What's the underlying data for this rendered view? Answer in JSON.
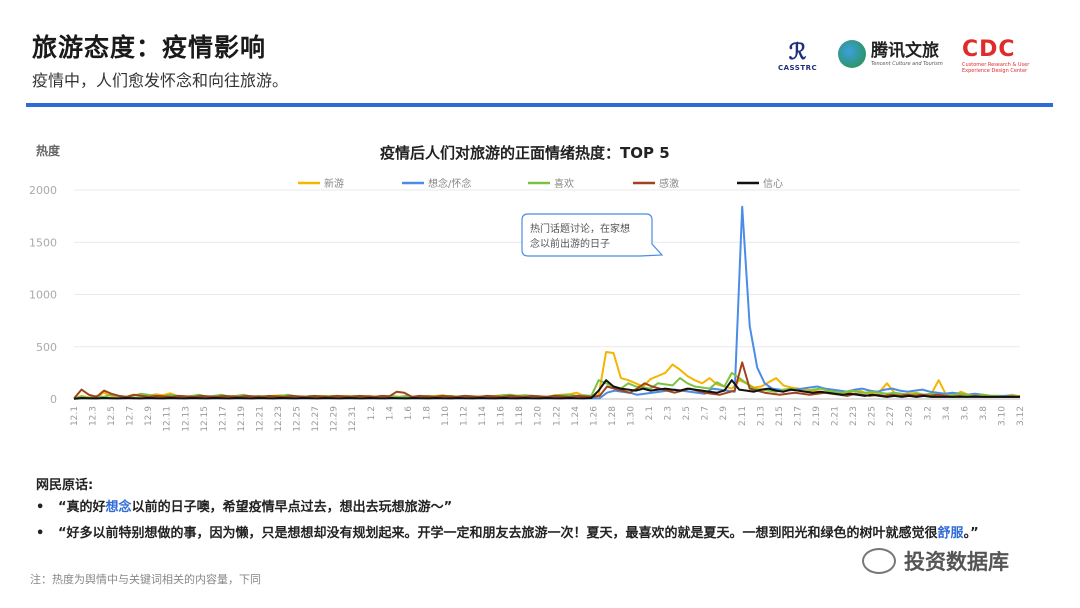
{
  "header": {
    "title": "旅游态度：疫情影响",
    "subtitle": "疫情中，人们愈发怀念和向往旅游。"
  },
  "logos": {
    "casstrc": "CASSTRC",
    "tencent_cn": "腾讯文旅",
    "tencent_en": "Tencent Culture and Tourism",
    "cdc": "CDC",
    "cdc_sub": "Customer Research & User Experience Design Center"
  },
  "comments": {
    "title": "网民原话:",
    "bullet": "•",
    "c1_pre": "“真的好",
    "c1_hl": "想念",
    "c1_post": "以前的日子噢，希望疫情早点过去，想出去玩想旅游～”",
    "c2_pre": "“好多以前特别想做的事，因为懒，只是想想却没有规划起来。开学一定和朋友去旅游一次！夏天，最喜欢的就是夏天。一想到阳光和绿色的树叶就感觉很",
    "c2_hl": "舒服",
    "c2_post": "。”"
  },
  "note": "注：热度为舆情中与关键词相关的内容量，下同",
  "watermark": "投资数据库",
  "chart_data": {
    "type": "line",
    "title": "疫情后人们对旅游的正面情绪热度：TOP 5",
    "ylabel": "热度",
    "xlabel": "",
    "ylim": [
      0,
      2000
    ],
    "yticks": [
      0,
      500,
      1000,
      1500,
      2000
    ],
    "grid": true,
    "legend_position": "top",
    "x_tick_labels": [
      "12.1",
      "12.3",
      "12.5",
      "12.7",
      "12.9",
      "12.11",
      "12.13",
      "12.15",
      "12.17",
      "12.19",
      "12.21",
      "12.23",
      "12.25",
      "12.27",
      "12.29",
      "12.31",
      "1.2",
      "1.4",
      "1.6",
      "1.8",
      "1.10",
      "1.12",
      "1.14",
      "1.16",
      "1.18",
      "1.20",
      "1.22",
      "1.24",
      "1.26",
      "1.28",
      "1.30",
      "2.1",
      "2.3",
      "2.5",
      "2.7",
      "2.9",
      "2.11",
      "2.13",
      "2.15",
      "2.17",
      "2.19",
      "2.21",
      "2.23",
      "2.25",
      "2.27",
      "2.29",
      "3.2",
      "3.4",
      "3.6",
      "3.8",
      "3.10",
      "3.12"
    ],
    "annotation": "热门话题讨论，在家想念以前出游的日子",
    "series": [
      {
        "name": "新游",
        "color": "#f4b400",
        "values": [
          5,
          30,
          15,
          20,
          60,
          30,
          25,
          20,
          40,
          25,
          30,
          45,
          35,
          55,
          30,
          20,
          25,
          15,
          20,
          25,
          30,
          25,
          30,
          35,
          20,
          25,
          20,
          30,
          35,
          20,
          15,
          25,
          20,
          25,
          30,
          15,
          25,
          30,
          20,
          25,
          30,
          20,
          25,
          30,
          20,
          25,
          20,
          20,
          25,
          30,
          35,
          20,
          25,
          30,
          20,
          25,
          25,
          30,
          35,
          40,
          30,
          35,
          30,
          25,
          20,
          35,
          40,
          45,
          60,
          30,
          25,
          40,
          450,
          440,
          200,
          180,
          150,
          120,
          190,
          220,
          250,
          330,
          280,
          220,
          180,
          150,
          200,
          140,
          120,
          100,
          180,
          150,
          110,
          120,
          160,
          200,
          130,
          110,
          100,
          90,
          80,
          70,
          60,
          80,
          70,
          60,
          90,
          60,
          50,
          70,
          150,
          60,
          40,
          50,
          60,
          40,
          50,
          180,
          40,
          30,
          70,
          40,
          30,
          40,
          30,
          20,
          30,
          40,
          25
        ]
      },
      {
        "name": "想念/怀念",
        "color": "#4a8ce6",
        "values": [
          2,
          5,
          8,
          5,
          10,
          8,
          6,
          8,
          10,
          6,
          8,
          10,
          6,
          8,
          10,
          6,
          8,
          10,
          6,
          8,
          10,
          6,
          8,
          10,
          6,
          8,
          10,
          6,
          8,
          10,
          6,
          8,
          10,
          6,
          8,
          10,
          6,
          8,
          10,
          6,
          8,
          10,
          6,
          8,
          10,
          6,
          8,
          10,
          6,
          8,
          10,
          6,
          8,
          10,
          6,
          8,
          10,
          6,
          8,
          10,
          6,
          8,
          10,
          6,
          8,
          10,
          6,
          8,
          10,
          6,
          8,
          60,
          80,
          70,
          60,
          40,
          50,
          60,
          70,
          80,
          90,
          80,
          70,
          60,
          50,
          100,
          90,
          80,
          70,
          1840,
          700,
          300,
          150,
          100,
          90,
          80,
          90,
          100,
          110,
          120,
          100,
          90,
          80,
          70,
          90,
          100,
          80,
          70,
          90,
          100,
          80,
          70,
          80,
          90,
          70,
          60,
          50,
          60,
          50,
          40,
          50,
          40,
          30,
          30,
          30,
          30,
          20
        ]
      },
      {
        "name": "喜欢",
        "color": "#7cc242",
        "values": [
          5,
          20,
          10,
          30,
          20,
          40,
          30,
          20,
          30,
          50,
          40,
          30,
          20,
          40,
          30,
          20,
          30,
          40,
          20,
          30,
          40,
          20,
          30,
          40,
          20,
          30,
          25,
          20,
          30,
          40,
          25,
          20,
          30,
          20,
          25,
          30,
          20,
          25,
          30,
          20,
          25,
          20,
          30,
          25,
          20,
          30,
          20,
          25,
          30,
          20,
          25,
          30,
          20,
          30,
          25,
          20,
          30,
          25,
          35,
          40,
          30,
          35,
          30,
          25,
          20,
          30,
          35,
          40,
          30,
          35,
          30,
          180,
          150,
          120,
          100,
          150,
          120,
          110,
          100,
          150,
          140,
          130,
          200,
          150,
          120,
          110,
          100,
          160,
          120,
          250,
          200,
          150,
          100,
          90,
          80,
          70,
          90,
          100,
          80,
          70,
          90,
          100,
          80,
          70,
          60,
          80,
          70,
          60,
          70,
          60,
          50,
          60,
          50,
          40,
          50,
          40,
          50,
          40,
          30,
          40,
          50,
          40,
          30,
          40,
          30,
          30,
          20,
          20,
          30
        ]
      },
      {
        "name": "感激",
        "color": "#a0451b",
        "values": [
          5,
          90,
          40,
          20,
          80,
          50,
          30,
          20,
          40,
          30,
          20,
          30,
          25,
          20,
          30,
          25,
          20,
          30,
          25,
          20,
          30,
          25,
          20,
          30,
          25,
          20,
          30,
          25,
          20,
          30,
          25,
          20,
          30,
          25,
          20,
          30,
          25,
          20,
          30,
          25,
          20,
          30,
          25,
          70,
          60,
          20,
          30,
          25,
          20,
          30,
          25,
          20,
          30,
          25,
          20,
          30,
          25,
          20,
          30,
          25,
          20,
          30,
          25,
          20,
          30,
          25,
          20,
          30,
          25,
          20,
          30,
          120,
          100,
          80,
          60,
          100,
          150,
          120,
          100,
          80,
          60,
          80,
          100,
          80,
          60,
          50,
          40,
          60,
          80,
          350,
          100,
          80,
          60,
          50,
          40,
          50,
          60,
          50,
          40,
          50,
          60,
          50,
          40,
          30,
          50,
          40,
          30,
          40,
          30,
          40,
          30,
          40,
          30,
          40,
          30,
          40,
          30,
          20,
          30,
          20,
          30,
          20,
          20,
          20,
          20,
          20,
          20
        ]
      },
      {
        "name": "信心",
        "color": "#111111",
        "values": [
          2,
          10,
          8,
          6,
          10,
          8,
          6,
          10,
          8,
          6,
          10,
          8,
          6,
          10,
          8,
          6,
          10,
          8,
          6,
          10,
          8,
          6,
          10,
          8,
          6,
          10,
          8,
          6,
          10,
          8,
          6,
          10,
          8,
          6,
          10,
          8,
          6,
          10,
          8,
          6,
          10,
          8,
          6,
          10,
          8,
          6,
          10,
          8,
          6,
          10,
          8,
          6,
          10,
          8,
          6,
          10,
          8,
          6,
          10,
          8,
          6,
          10,
          8,
          6,
          10,
          8,
          6,
          10,
          8,
          6,
          10,
          80,
          180,
          120,
          100,
          90,
          80,
          100,
          80,
          90,
          100,
          90,
          80,
          100,
          90,
          80,
          70,
          60,
          80,
          180,
          90,
          80,
          70,
          90,
          100,
          80,
          70,
          90,
          80,
          70,
          60,
          70,
          60,
          50,
          40,
          50,
          40,
          30,
          40,
          30,
          20,
          30,
          20,
          30,
          20,
          30,
          20,
          20,
          20,
          20,
          20,
          20,
          20,
          20,
          20,
          20,
          20,
          20,
          20
        ]
      }
    ]
  }
}
